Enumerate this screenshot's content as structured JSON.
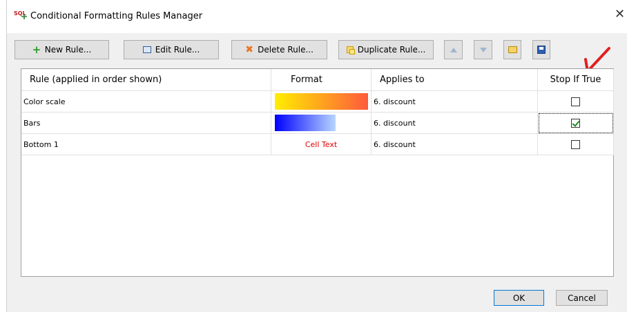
{
  "window": {
    "title": "Conditional Formatting Rules Manager",
    "close_glyph": "✕",
    "app_icon_text": "SQL"
  },
  "toolbar": {
    "new_rule": "New Rule...",
    "edit_rule": "Edit Rule...",
    "delete_rule": "Delete Rule...",
    "duplicate_rule": "Duplicate Rule..."
  },
  "table": {
    "headers": [
      "Rule (applied in order shown)",
      "Format",
      "Applies to",
      "Stop If True"
    ],
    "rows": [
      {
        "rule": "Color scale",
        "format_type": "color-scale",
        "applies_to": "6. discount",
        "stop_if_true": false
      },
      {
        "rule": "Bars",
        "format_type": "bars",
        "applies_to": "6. discount",
        "stop_if_true": true
      },
      {
        "rule": "Bottom 1",
        "format_type": "text",
        "format_text": "Cell Text",
        "applies_to": "6. discount",
        "stop_if_true": false
      }
    ]
  },
  "colors": {
    "color_scale_start": "#ffee00",
    "color_scale_end": "#ff5a3c",
    "bars_start": "#0000ff",
    "bars_end": "#b8d6ff",
    "cell_text": "#e00000",
    "annotation_arrow": "#e02020"
  },
  "footer": {
    "ok": "OK",
    "cancel": "Cancel"
  }
}
